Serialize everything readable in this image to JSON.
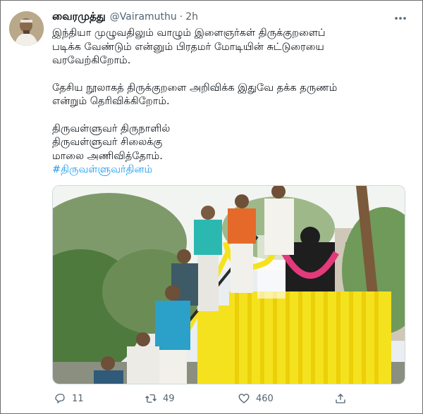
{
  "tweet": {
    "author_name": "வைரமுத்து",
    "handle": "@Vairamuthu",
    "separator": "·",
    "time": "2h",
    "paragraphs": [
      [
        "இந்தியா முழுவதிலும் வாழும் இளைஞர்கள் திருக்குறளைப்",
        "படிக்க வேண்டும் என்னும் பிரதமர் மோடியின் சுட்டுரையை",
        "வரவேற்கிறோம்."
      ],
      [
        "தேசிய நூலாகத் திருக்குறளை அறிவிக்க இதுவே தக்க தருணம்",
        "என்றும் தெரிவிக்கிறோம்."
      ],
      [
        "திருவள்ளுவர் திருநாளில்",
        "திருவள்ளுவர் சிலைக்கு",
        "மாலை அணிவித்தோம்."
      ]
    ],
    "hashtag": "#திருவள்ளுவர்தினம்"
  },
  "actions": {
    "reply_count": "11",
    "retweet_count": "49",
    "like_count": "460"
  },
  "icons": [
    "more-icon",
    "reply-icon",
    "retweet-icon",
    "like-icon",
    "share-icon"
  ],
  "colors": {
    "link": "#1d9bf0",
    "secondary_text": "#536471",
    "marigold": "#f5e21e"
  }
}
